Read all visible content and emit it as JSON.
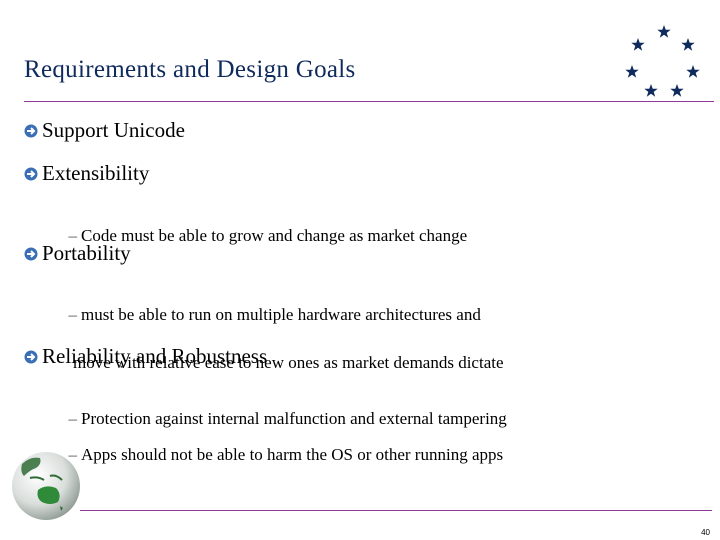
{
  "slide": {
    "title": "Requirements and Design Goals",
    "page_number": "40",
    "colors": {
      "title": "#0f2a5c",
      "rule": "#8e3a96",
      "bullet_arrow": "#3a6fb5",
      "stars": "#0f2a5c"
    },
    "decorations": {
      "top_right": "star-circle-icon",
      "bottom_left": "globe-icon"
    },
    "bullets": [
      {
        "label": "Support Unicode",
        "subitems": []
      },
      {
        "label": "Extensibility",
        "subitems": [
          {
            "dash": "–",
            "text": "Code must be able to grow and change as market change"
          }
        ]
      },
      {
        "label": "Portability",
        "subitems": [
          {
            "dash": "–",
            "text": "must be able to run on multiple hardware architectures and",
            "continuation": "move with relative ease to new ones as market demands dictate"
          }
        ]
      },
      {
        "label": "Reliability and Robustness",
        "subitems": [
          {
            "dash": "–",
            "text": "Protection against internal malfunction and external tampering"
          },
          {
            "dash": "–",
            "text": "Apps should not be able to harm the OS or other running apps"
          }
        ]
      }
    ]
  }
}
